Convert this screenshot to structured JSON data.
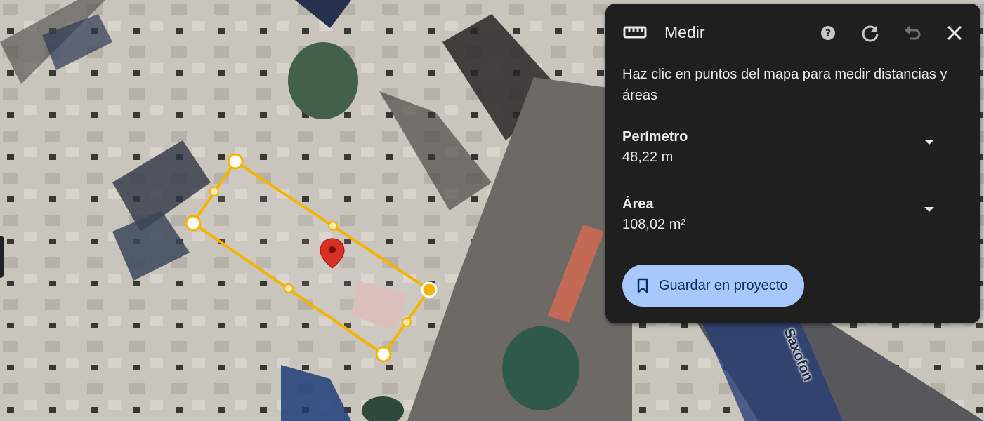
{
  "map": {
    "street_label": "Saxofon",
    "colors": {
      "shape_stroke": "#f4b400",
      "pin": "#d93025"
    }
  },
  "panel": {
    "icon": "ruler-icon",
    "title": "Medir",
    "toolbar": {
      "help": "help-icon",
      "refresh": "refresh-icon",
      "undo": "undo-icon",
      "close": "close-icon"
    },
    "instructions": "Haz clic en puntos del mapa para medir distancias y áreas",
    "perimeter": {
      "label": "Perímetro",
      "value": "48,22 m"
    },
    "area": {
      "label": "Área",
      "value": "108,02 m²"
    },
    "save_button": {
      "label": "Guardar en proyecto",
      "icon": "bookmark-icon",
      "color": "#a8c7fa"
    }
  }
}
